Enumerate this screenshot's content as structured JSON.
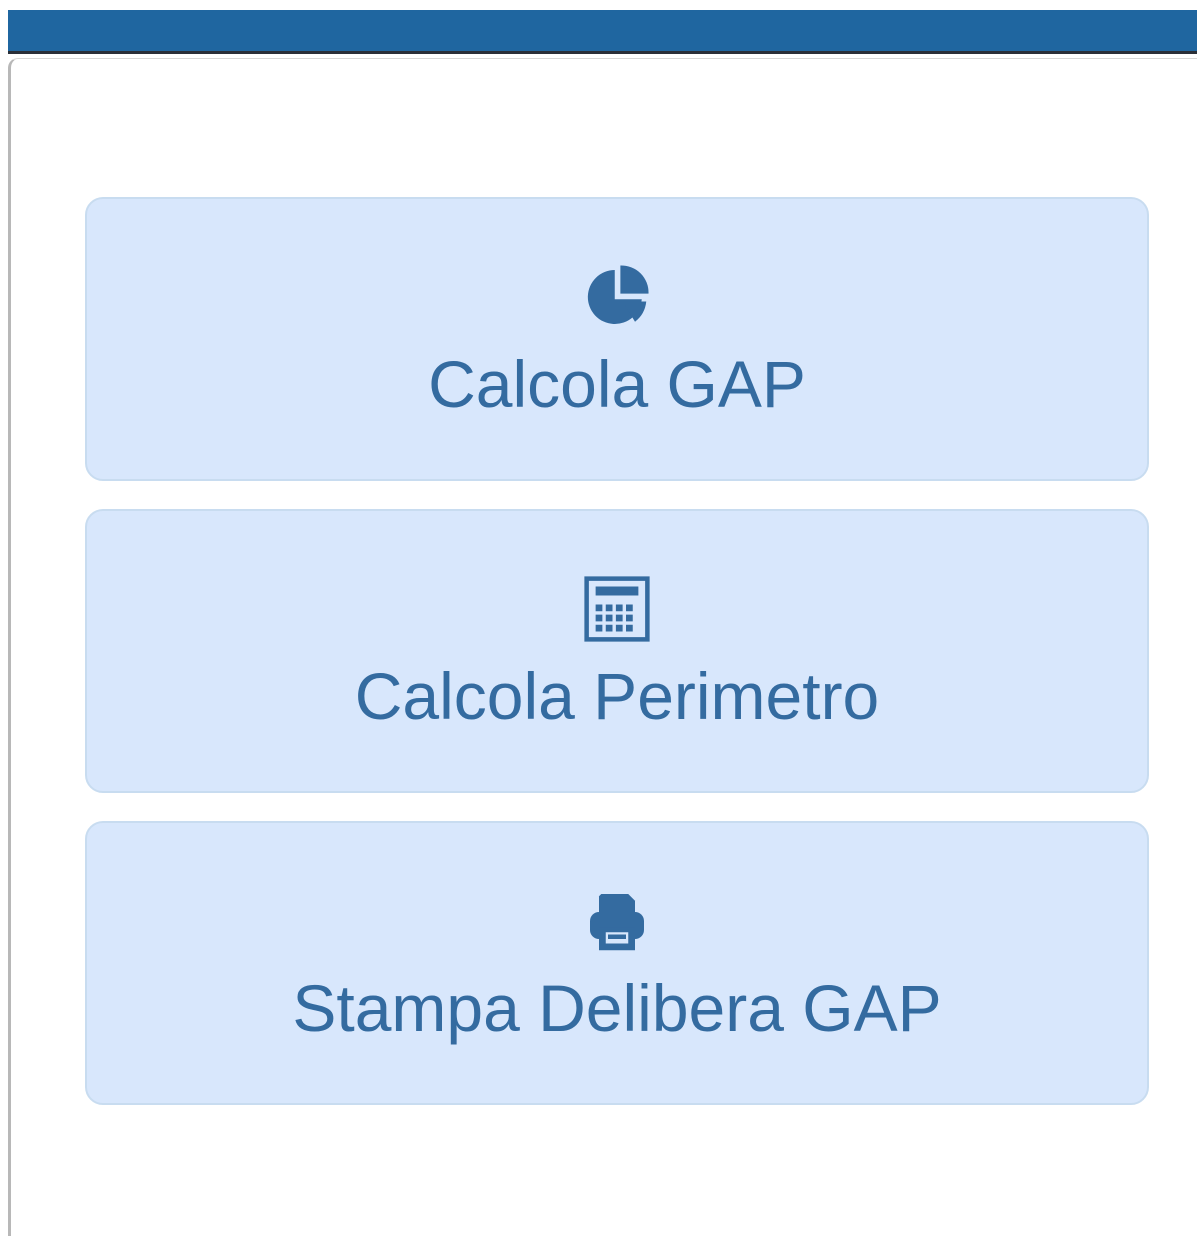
{
  "theme": {
    "top_bar_color": "#1f66a0",
    "button_background": "#d8e7fc",
    "button_border": "#c8dcf0",
    "button_text": "#346ba0"
  },
  "actions": [
    {
      "label": "Calcola GAP",
      "icon": "pie-chart-icon"
    },
    {
      "label": "Calcola Perimetro",
      "icon": "calculator-icon"
    },
    {
      "label": "Stampa Delibera GAP",
      "icon": "printer-icon"
    }
  ]
}
